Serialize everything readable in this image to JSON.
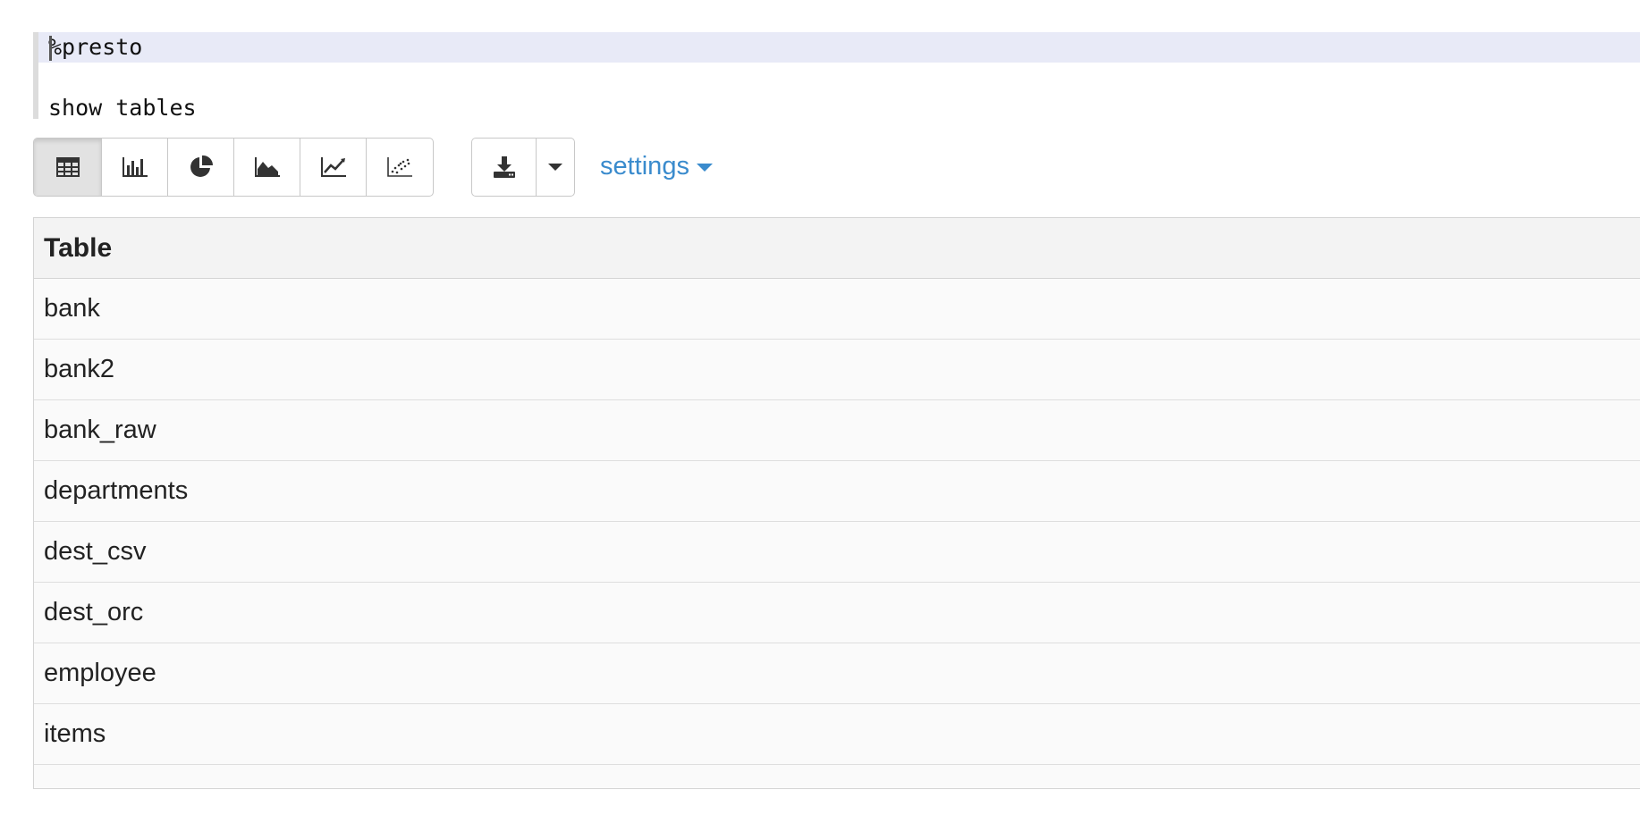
{
  "editor": {
    "line1": "%presto",
    "line2": "show tables"
  },
  "toolbar": {
    "chart_buttons": [
      {
        "name": "table-view-button",
        "icon": "table-icon",
        "active": true
      },
      {
        "name": "bar-chart-button",
        "icon": "bar-chart-icon",
        "active": false
      },
      {
        "name": "pie-chart-button",
        "icon": "pie-chart-icon",
        "active": false
      },
      {
        "name": "area-chart-button",
        "icon": "area-chart-icon",
        "active": false
      },
      {
        "name": "line-chart-button",
        "icon": "line-chart-icon",
        "active": false
      },
      {
        "name": "scatter-chart-button",
        "icon": "scatter-chart-icon",
        "active": false
      }
    ],
    "download_icon": "download-icon",
    "download_caret_icon": "caret-down-icon",
    "settings_label": "settings"
  },
  "table": {
    "header": "Table",
    "rows": [
      "bank",
      "bank2",
      "bank_raw",
      "departments",
      "dest_csv",
      "dest_orc",
      "employee",
      "items",
      "..."
    ]
  },
  "colors": {
    "accent": "#3a8bcd",
    "active_line": "#e8eaf7",
    "header_bg": "#f3f3f3",
    "row_bg": "#fafafa"
  }
}
